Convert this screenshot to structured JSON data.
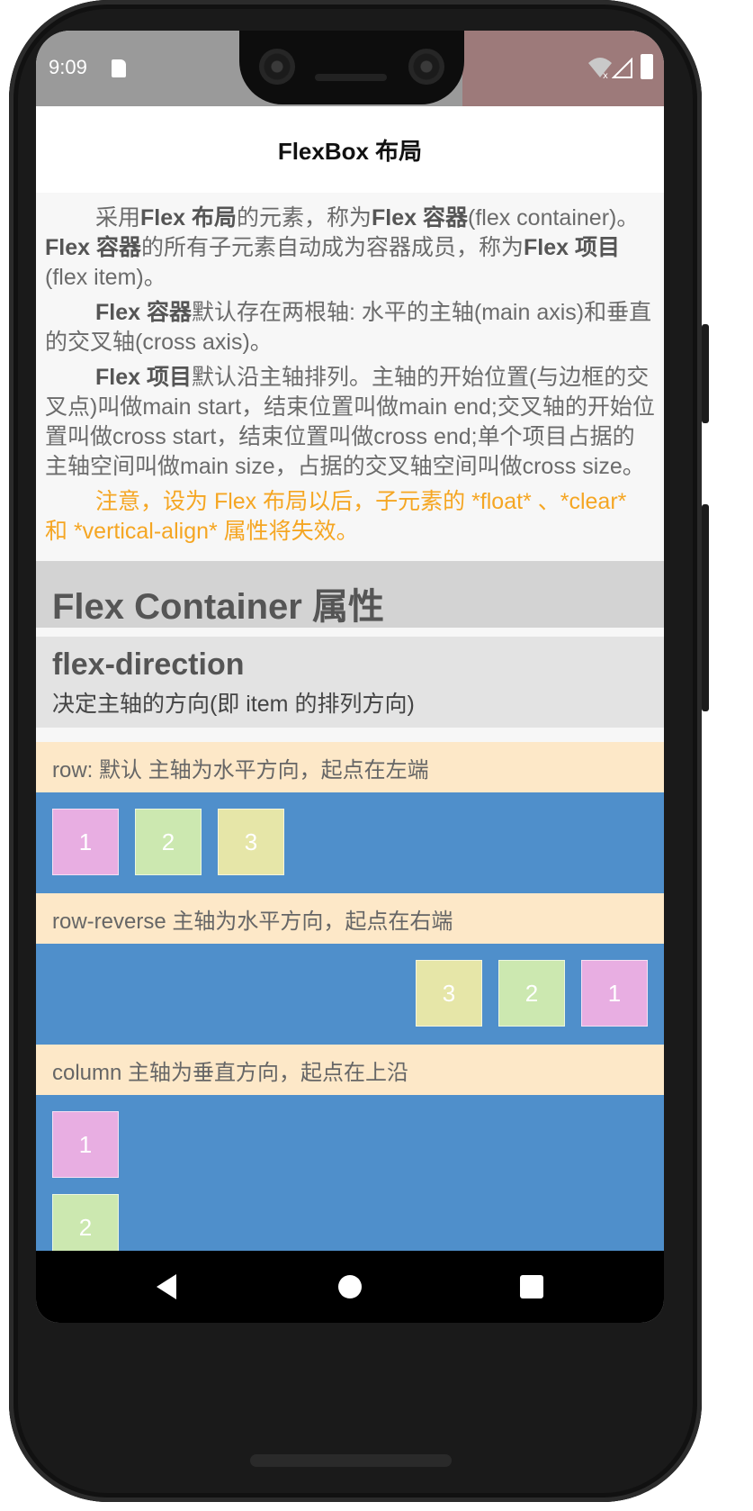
{
  "status_bar": {
    "time": "9:09",
    "icons": [
      "sd-card-icon",
      "wifi-icon",
      "signal-icon",
      "battery-icon"
    ]
  },
  "app_bar": {
    "title": "FlexBox 布局"
  },
  "intro": {
    "p1": {
      "a": "采用",
      "b": "Flex 布局",
      "c": "的元素，称为",
      "d": "Flex 容器",
      "e": "(flex container)。",
      "f": "Flex 容器",
      "g": "的所有子元素自动成为容器成员，称为",
      "h": "Flex 项目",
      "i": "(flex item)。"
    },
    "p2": {
      "a": "Flex 容器",
      "b": "默认存在两根轴: 水平的主轴(main axis)和垂直的交叉轴(cross axis)。"
    },
    "p3": {
      "a": "Flex 项目",
      "b": "默认沿主轴排列。主轴的开始位置(与边框的交叉点)叫做main start，结束位置叫做main end;交叉轴的开始位置叫做cross start，结束位置叫做cross end;单个项目占据的主轴空间叫做main size，占据的交叉轴空间叫做cross size。"
    },
    "note": "注意，设为 Flex 布局以后，子元素的 *float* 、*clear* 和 *vertical-align* 属性将失效。"
  },
  "section": {
    "title": "Flex Container 属性"
  },
  "property": {
    "name": "flex-direction",
    "description": "决定主轴的方向(即 item 的排列方向)"
  },
  "demos": {
    "row": {
      "label": "row: 默认 主轴为水平方向，起点在左端",
      "items": [
        "1",
        "2",
        "3"
      ]
    },
    "row_reverse": {
      "label": "row-reverse 主轴为水平方向，起点在右端",
      "items": [
        "1",
        "2",
        "3"
      ]
    },
    "column": {
      "label": "column 主轴为垂直方向，起点在上沿",
      "items": [
        "1",
        "2"
      ]
    }
  },
  "colors": {
    "item_1": "#e8aee2",
    "item_2": "#cce8b0",
    "item_3": "#e6e6a8",
    "demo_background": "#4f8fcb",
    "label_background": "#fde8c8",
    "note_color": "#f5a623"
  },
  "nav_bar": {
    "icons": [
      "back-icon",
      "home-icon",
      "recents-icon"
    ]
  }
}
